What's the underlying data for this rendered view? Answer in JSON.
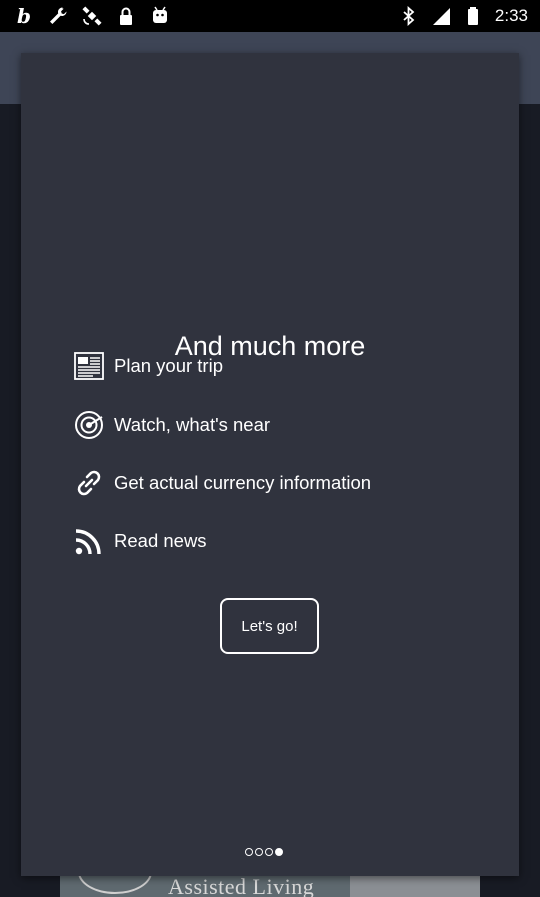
{
  "status_bar": {
    "time": "2:33",
    "left_icons": [
      "b-app-icon",
      "wrench-icon",
      "satellite-icon",
      "lock-icon",
      "android-icon"
    ],
    "right_icons": [
      "bluetooth-icon",
      "signal-icon",
      "battery-icon"
    ]
  },
  "background": {
    "ad_text": "Assisted Living"
  },
  "dialog": {
    "title": "And much more",
    "features": [
      {
        "icon": "newspaper-icon",
        "label": "Plan your trip"
      },
      {
        "icon": "radar-icon",
        "label": "Watch, what's near"
      },
      {
        "icon": "link-icon",
        "label": "Get actual currency information"
      },
      {
        "icon": "rss-icon",
        "label": "Read news"
      }
    ],
    "button_label": "Let's go!",
    "pager": {
      "total": 4,
      "active": 4
    }
  }
}
